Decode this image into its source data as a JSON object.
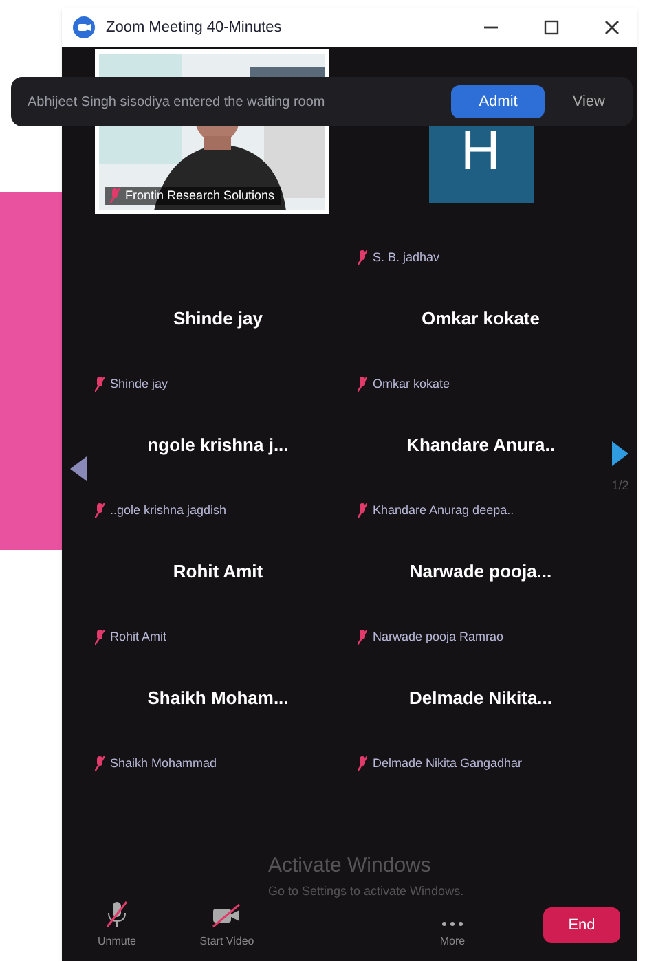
{
  "window": {
    "title": "Zoom Meeting 40-Minutes"
  },
  "notification": {
    "message": "Abhijeet Singh sisodiya entered the waiting room",
    "buttons": [
      {
        "label": "Admit",
        "kind": "primary"
      },
      {
        "label": "View",
        "kind": "link"
      }
    ]
  },
  "tiles": [
    {
      "kind": "video",
      "name": "Frontin Research Solutions",
      "muted": true
    },
    {
      "kind": "avatar",
      "initial": "H",
      "name": "S. B. jadhav",
      "muted": true
    },
    {
      "kind": "name",
      "display": "Shinde jay",
      "name": "Shinde jay",
      "muted": true
    },
    {
      "kind": "name",
      "display": "Omkar kokate",
      "name": "Omkar kokate",
      "muted": true
    },
    {
      "kind": "name",
      "display": "ngole krishna j...",
      "name": "..gole krishna jagdish",
      "muted": true
    },
    {
      "kind": "name",
      "display": "Khandare Anura..",
      "name": "Khandare Anurag deepa..",
      "muted": true
    },
    {
      "kind": "name",
      "display": "Rohit Amit",
      "name": "Rohit Amit",
      "muted": true
    },
    {
      "kind": "name",
      "display": "Narwade pooja...",
      "name": "Narwade pooja Ramrao",
      "muted": true
    },
    {
      "kind": "name",
      "display": "Shaikh Moham...",
      "name": "Shaikh Mohammad",
      "muted": true
    },
    {
      "kind": "name",
      "display": "Delmade Nikita...",
      "name": "Delmade Nikita Gangadhar",
      "muted": true
    }
  ],
  "page_indicator": "1/2",
  "os_notice": {
    "title": "Activate Windows",
    "text": "Go to Settings to activate Windows."
  },
  "toolbar": [
    {
      "label": "Unmute",
      "kind": "mic",
      "off": true
    },
    {
      "label": "Start Video",
      "kind": "video",
      "off": true
    },
    {
      "label": "More",
      "kind": "more"
    }
  ],
  "end_button": "End"
}
